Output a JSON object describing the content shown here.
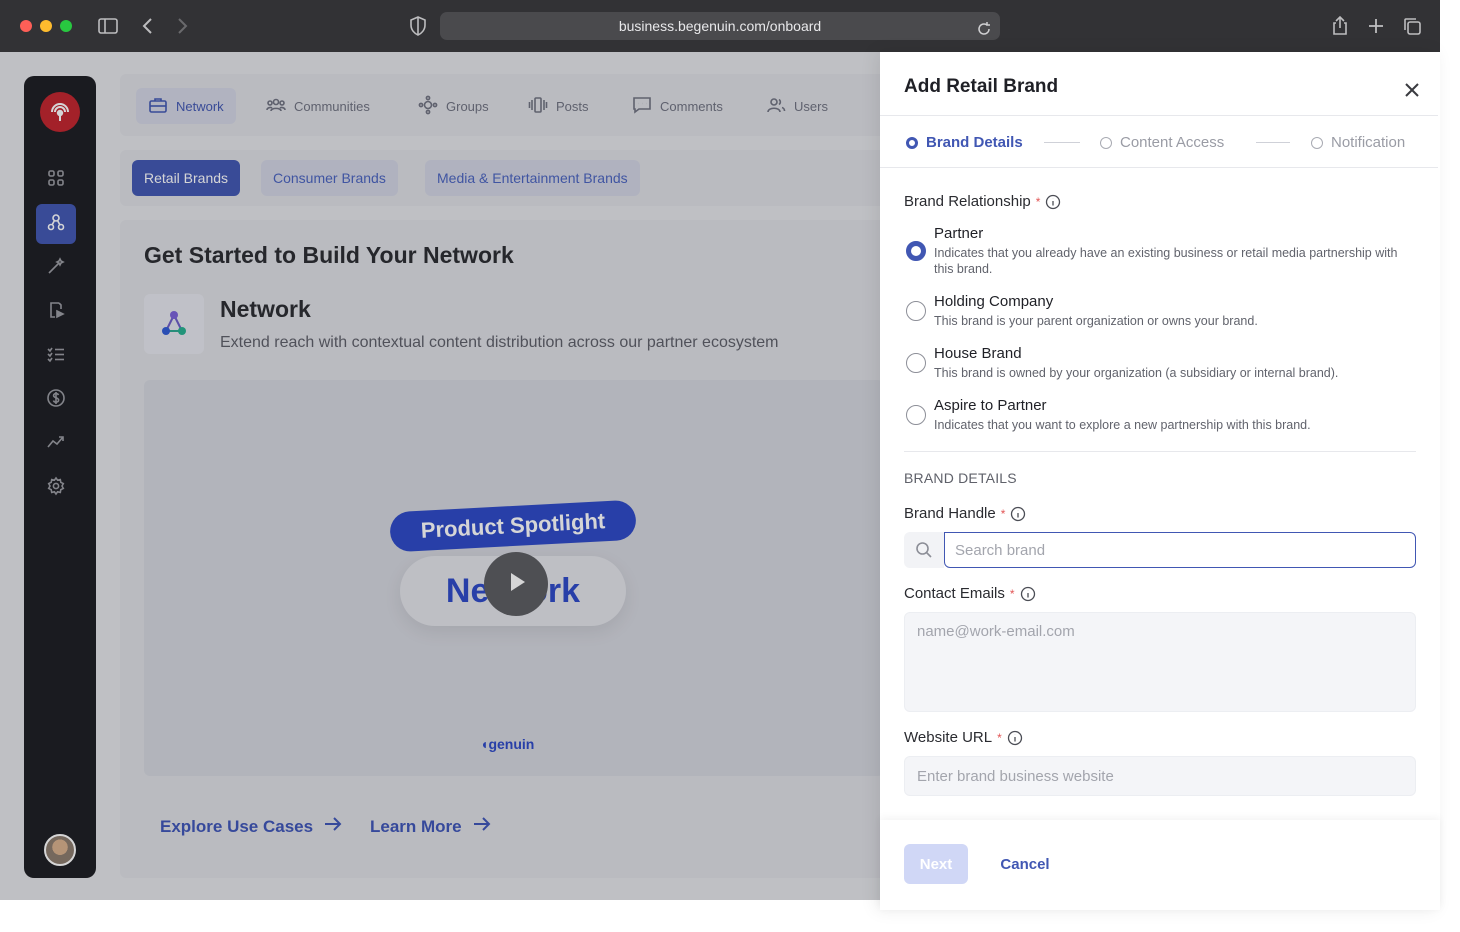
{
  "browser": {
    "url": "business.begenuin.com/onboard"
  },
  "sidebar": {
    "items": [
      {
        "icon": "grid-icon"
      },
      {
        "icon": "network-icon",
        "active": true
      },
      {
        "icon": "magic-wand-icon"
      },
      {
        "icon": "video-file-icon"
      },
      {
        "icon": "checklist-icon"
      },
      {
        "icon": "dollar-icon"
      },
      {
        "icon": "analytics-icon"
      },
      {
        "icon": "settings-icon"
      }
    ]
  },
  "topnav": {
    "tabs": [
      {
        "label": "Network",
        "icon": "briefcase-icon",
        "active": true
      },
      {
        "label": "Communities",
        "icon": "users-group-icon"
      },
      {
        "label": "Groups",
        "icon": "groups-icon"
      },
      {
        "label": "Posts",
        "icon": "posts-icon"
      },
      {
        "label": "Comments",
        "icon": "comments-icon"
      },
      {
        "label": "Users",
        "icon": "users-icon"
      }
    ]
  },
  "subtabs": [
    {
      "label": "Retail Brands",
      "active": true
    },
    {
      "label": "Consumer Brands"
    },
    {
      "label": "Media & Entertainment Brands"
    }
  ],
  "main": {
    "title": "Get Started to Build Your Network",
    "network_title": "Network",
    "network_desc": "Extend reach with contextual content distribution across our partner ecosystem",
    "video": {
      "spotlight": "Product Spotlight",
      "network_word": "Network",
      "brand": "genuin"
    },
    "explore_link": "Explore Use Cases",
    "learn_link": "Learn More"
  },
  "modal": {
    "title": "Add Retail Brand",
    "steps": [
      {
        "label": "Brand Details",
        "active": true
      },
      {
        "label": "Content Access"
      },
      {
        "label": "Notification"
      }
    ],
    "relationship_label": "Brand Relationship",
    "required_mark": "*",
    "options": [
      {
        "title": "Partner",
        "desc": "Indicates that you already have an existing business or retail media partnership with this brand.",
        "selected": true
      },
      {
        "title": "Holding Company",
        "desc": "This brand is your parent organization or owns your brand."
      },
      {
        "title": "House Brand",
        "desc": "This brand is owned by your organization (a subsidiary or internal brand)."
      },
      {
        "title": "Aspire to Partner",
        "desc": "Indicates that you want to explore a new partnership with this brand."
      }
    ],
    "brand_details_caption": "BRAND DETAILS",
    "handle_label": "Brand Handle",
    "handle_placeholder": "Search brand",
    "emails_label": "Contact Emails",
    "emails_placeholder": "name@work-email.com",
    "website_label": "Website URL",
    "website_placeholder": "Enter brand business website",
    "next_label": "Next",
    "cancel_label": "Cancel"
  },
  "colors": {
    "accent": "#4157b3",
    "sidebar_bg": "#1c1d21",
    "required": "#e25555"
  }
}
